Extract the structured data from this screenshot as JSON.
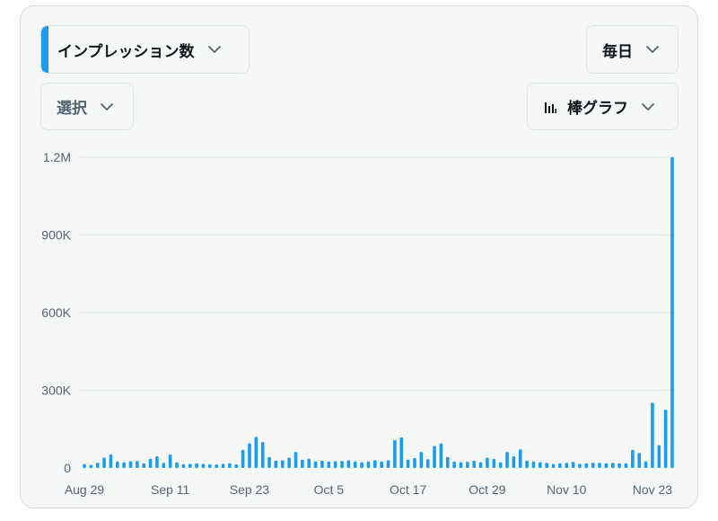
{
  "controls": {
    "metric_label": "インプレッション数",
    "period_label": "毎日",
    "select_label": "選択",
    "chart_type_label": "棒グラフ"
  },
  "colors": {
    "bar": "#1d9bf0",
    "accent": "#1d9bf0",
    "grid": "#e1e6e8",
    "tick_text": "#536471"
  },
  "icons": {
    "chevron": "chevron-down-icon",
    "chart_type": "bar-chart-icon"
  },
  "chart_data": {
    "type": "bar",
    "ylim": [
      0,
      1200000
    ],
    "yticks": [
      {
        "value": 0,
        "label": "0"
      },
      {
        "value": 300000,
        "label": "300K"
      },
      {
        "value": 600000,
        "label": "600K"
      },
      {
        "value": 900000,
        "label": "900K"
      },
      {
        "value": 1200000,
        "label": "1.2M"
      }
    ],
    "x_tick_labels": [
      {
        "index": 0,
        "label": "Aug 29"
      },
      {
        "index": 13,
        "label": "Sep 11"
      },
      {
        "index": 25,
        "label": "Sep 23"
      },
      {
        "index": 37,
        "label": "Oct 5"
      },
      {
        "index": 49,
        "label": "Oct 17"
      },
      {
        "index": 61,
        "label": "Oct 29"
      },
      {
        "index": 73,
        "label": "Nov 10"
      },
      {
        "index": 86,
        "label": "Nov 23"
      }
    ],
    "values": [
      15000,
      12000,
      20000,
      40000,
      52000,
      25000,
      22000,
      26000,
      27000,
      18000,
      35000,
      45000,
      20000,
      52000,
      22000,
      15000,
      16000,
      18000,
      16000,
      14000,
      14000,
      16000,
      18000,
      14000,
      70000,
      95000,
      120000,
      100000,
      42000,
      28000,
      30000,
      40000,
      62000,
      32000,
      36000,
      25000,
      28000,
      25000,
      26000,
      27000,
      30000,
      25000,
      22000,
      25000,
      30000,
      25000,
      30000,
      108000,
      118000,
      32000,
      38000,
      62000,
      34000,
      85000,
      95000,
      42000,
      25000,
      22000,
      24000,
      28000,
      22000,
      40000,
      35000,
      22000,
      62000,
      45000,
      72000,
      28000,
      25000,
      22000,
      20000,
      15000,
      18000,
      20000,
      24000,
      16000,
      18000,
      20000,
      20000,
      18000,
      20000,
      18000,
      18000,
      70000,
      58000,
      25000,
      252000,
      88000,
      225000,
      1200000
    ]
  }
}
